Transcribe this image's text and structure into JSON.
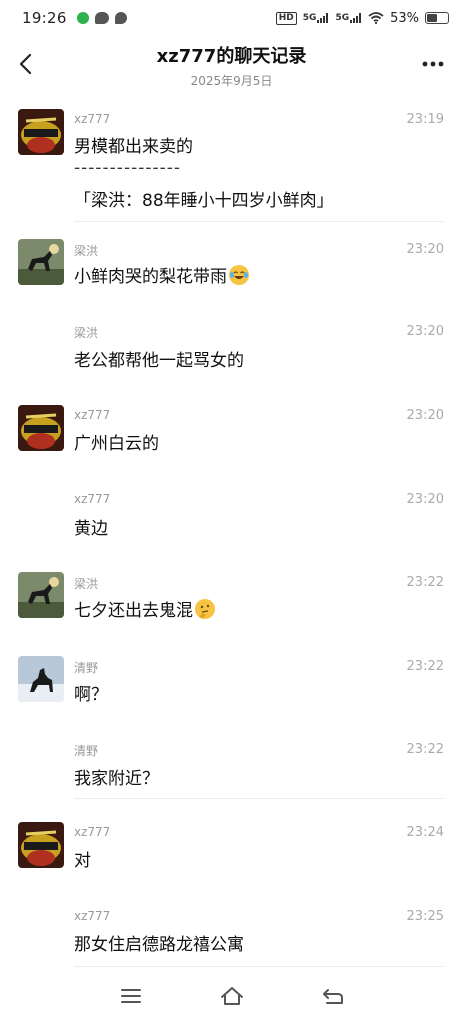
{
  "status_bar": {
    "time": "19:26",
    "battery_text": "53%",
    "battery_level": 0.53,
    "network_labels": [
      "5G",
      "5G"
    ],
    "hd_label": "HD"
  },
  "header": {
    "title": "xz777的聊天记录",
    "date": "2025年9月5日",
    "back_icon": "chevron-left-icon",
    "more_icon": "more-dots-icon"
  },
  "messages": [
    {
      "sender": "xz777",
      "time": "23:19",
      "text": "男模都出来卖的",
      "separator": "---------------",
      "quote": "「梁洪：88年睡小十四岁小鲜肉」",
      "avatar": "avatar-xz777"
    },
    {
      "sender": "梁洪",
      "time": "23:20",
      "text": "小鲜肉哭的梨花带雨",
      "emoji": "laughing-tears-emoji",
      "avatar": "avatar-lianghong"
    },
    {
      "sender": "梁洪",
      "time": "23:20",
      "text": "老公都帮他一起骂女的"
    },
    {
      "sender": "xz777",
      "time": "23:20",
      "text": "广州白云的",
      "avatar": "avatar-xz777"
    },
    {
      "sender": "xz777",
      "time": "23:20",
      "text": "黄边"
    },
    {
      "sender": "梁洪",
      "time": "23:22",
      "text": "七夕还出去鬼混",
      "emoji": "thinking-emoji",
      "avatar": "avatar-lianghong"
    },
    {
      "sender": "清野",
      "time": "23:22",
      "text": "啊？",
      "avatar": "avatar-qingye"
    },
    {
      "sender": "清野",
      "time": "23:22",
      "text": "我家附近？"
    },
    {
      "sender": "xz777",
      "time": "23:24",
      "text": "对",
      "avatar": "avatar-xz777"
    },
    {
      "sender": "xz777",
      "time": "23:25",
      "text": "那女住启德路龙禧公寓"
    }
  ],
  "nav_bar": {
    "icons": [
      "menu-icon",
      "home-icon",
      "back-icon"
    ]
  },
  "colors": {
    "background": "#ffffff",
    "text": "#111111",
    "meta_text": "#999999",
    "divider": "#ececec"
  }
}
